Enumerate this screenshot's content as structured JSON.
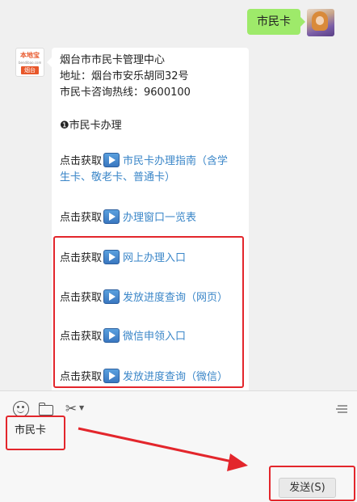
{
  "outgoing_message": {
    "text": "市民卡"
  },
  "incoming_message": {
    "lines": [
      "烟台市市民卡管理中心",
      "地址：烟台市安乐胡同32号",
      "市民卡咨询热线：9600100"
    ],
    "section_bullet": "❶",
    "section_title": "市民卡办理",
    "get_prefix": "点击获取",
    "links": [
      {
        "line1": "市民卡办理指南（含学",
        "line2": "生卡、敬老卡、普通卡）"
      },
      {
        "line1": "办理窗口一览表"
      },
      {
        "line1": "网上办理入口"
      },
      {
        "line1": "发放进度查询（网页）"
      },
      {
        "line1": "微信申领入口"
      },
      {
        "line1": "发放进度查询（微信）"
      }
    ]
  },
  "bot_avatar": {
    "brand": "本地宝",
    "sub": "bendibao.com",
    "city": "烟台"
  },
  "toolbar": {
    "icons": [
      "smile-icon",
      "folder-icon",
      "scissors-icon",
      "chevron-down-icon",
      "history-icon"
    ]
  },
  "input": {
    "value": "市民卡"
  },
  "send_button": {
    "label": "发送(S)"
  },
  "colors": {
    "bubble_out": "#9eea6a",
    "link": "#3a86c8",
    "highlight": "#e3262c"
  }
}
